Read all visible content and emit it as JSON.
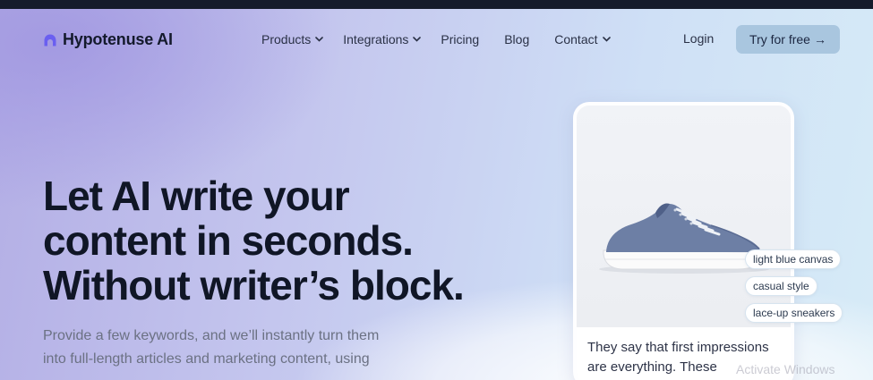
{
  "brand": {
    "name": "Hypotenuse AI",
    "logo_icon": "hypotenuse-logo-icon"
  },
  "nav": {
    "items": [
      {
        "label": "Products",
        "has_dropdown": true
      },
      {
        "label": "Integrations",
        "has_dropdown": true
      },
      {
        "label": "Pricing",
        "has_dropdown": false
      },
      {
        "label": "Blog",
        "has_dropdown": false
      },
      {
        "label": "Contact",
        "has_dropdown": true
      }
    ],
    "login_label": "Login",
    "cta_label": "Try for free",
    "cta_arrow": "→"
  },
  "hero": {
    "headline_lines": [
      "Let AI write your",
      "content in seconds.",
      "Without writer’s block."
    ],
    "subtext_lines": [
      "Provide a few keywords, and we’ll instantly turn them",
      "into full-length articles and marketing content, using"
    ]
  },
  "product_card": {
    "image_icon": "sneaker-image",
    "text_lines": [
      "They say that first impressions",
      "are everything. These"
    ],
    "tags": [
      "light blue canvas",
      "casual style",
      "lace-up sneakers"
    ]
  },
  "watermark": "Activate Windows",
  "colors": {
    "topbar": "#151b2b",
    "headline": "#101626",
    "cta_bg": "#a9c6df",
    "logo_accent": "#6a5ff0"
  }
}
